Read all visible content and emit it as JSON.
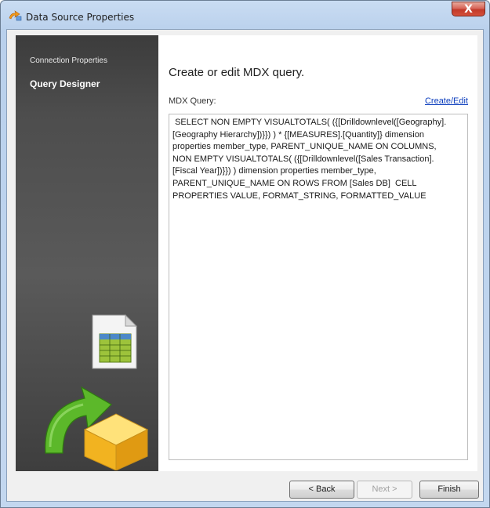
{
  "window": {
    "title": "Data Source Properties",
    "close_label": "X"
  },
  "sidebar": {
    "items": [
      {
        "label": "Connection Properties",
        "selected": false
      },
      {
        "label": "Query Designer",
        "selected": true
      }
    ]
  },
  "main": {
    "heading": "Create or edit MDX query.",
    "query_label": "MDX Query:",
    "create_edit_link": "Create/Edit",
    "query_text": " SELECT NON EMPTY VISUALTOTALS( ({[Drilldownlevel([Geography].\n[Geography Hierarchy])}}) ) * {[MEASURES].[Quantity]} dimension\nproperties member_type, PARENT_UNIQUE_NAME ON COLUMNS,\nNON EMPTY VISUALTOTALS( ({[Drilldownlevel([Sales Transaction].\n[Fiscal Year])}}) ) dimension properties member_type,\nPARENT_UNIQUE_NAME ON ROWS FROM [Sales DB]  CELL\nPROPERTIES VALUE, FORMAT_STRING, FORMATTED_VALUE"
  },
  "footer": {
    "back_label": "< Back",
    "next_label": "Next >",
    "finish_label": "Finish"
  },
  "colors": {
    "sidebar_bg": "#4d4d4d",
    "link": "#0b3dbd",
    "close_button": "#c23a2a"
  }
}
